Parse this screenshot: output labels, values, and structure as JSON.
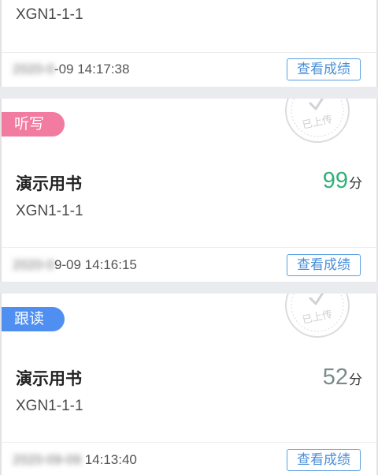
{
  "records": [
    {
      "code": "XGN1-1-1",
      "time_hidden": "2020-0",
      "time_visible": "-09 14:17:38",
      "action_label": "查看成绩"
    },
    {
      "tag": "听写",
      "tag_color": "#f27ba0",
      "stamp_text": "已上传",
      "book": "演示用书",
      "code": "XGN1-1-1",
      "score": "99",
      "score_unit": "分",
      "score_color": "#2fb27a",
      "time_hidden": "2020-0",
      "time_visible": "9-09 14:16:15",
      "action_label": "查看成绩"
    },
    {
      "tag": "跟读",
      "tag_color": "#4f8ff2",
      "stamp_text": "已上传",
      "book": "演示用书",
      "code": "XGN1-1-1",
      "score": "52",
      "score_unit": "分",
      "score_color": "#7b8a8a",
      "time_hidden": "2020-09-09",
      "time_visible": " 14:13:40",
      "action_label": "查看成绩"
    }
  ],
  "icons": {
    "stamp": "check-stamp-icon"
  }
}
